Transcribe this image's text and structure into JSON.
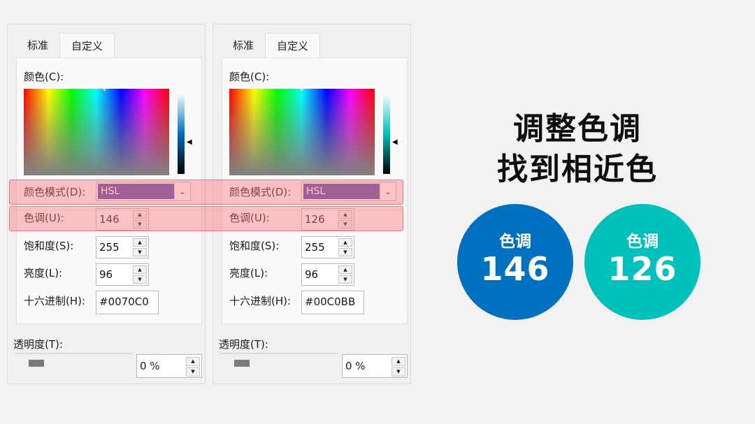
{
  "left_dialog": {
    "tabs": [
      "标准",
      "自定义"
    ],
    "colors_label": "颜色(C):",
    "mode_label": "颜色模式(D):",
    "mode_value": "HSL",
    "hue_label": "色调(U):",
    "hue_value": "146",
    "sat_label": "饱和度(S):",
    "sat_value": "255",
    "lum_label": "亮度(L):",
    "lum_value": "96",
    "hex_label": "十六进制(H):",
    "hex_value": "#0070C0",
    "transparency_label": "透明度(T):",
    "transparency_value": "0 %",
    "lum_color": "#0070c0"
  },
  "right_dialog": {
    "tabs": [
      "标准",
      "自定义"
    ],
    "colors_label": "颜色(C):",
    "mode_label": "颜色模式(D):",
    "mode_value": "HSL",
    "hue_label": "色调(U):",
    "hue_value": "126",
    "sat_label": "饱和度(S):",
    "sat_value": "255",
    "lum_label": "亮度(L):",
    "lum_value": "96",
    "hex_label": "十六进制(H):",
    "hex_value": "#00C0BB",
    "transparency_label": "透明度(T):",
    "transparency_value": "0 %",
    "lum_color": "#00c0bb"
  },
  "headline": {
    "line1": "调整色调",
    "line2": "找到相近色"
  },
  "badges": [
    {
      "label": "色调",
      "value": "146",
      "color": "#0070c0"
    },
    {
      "label": "色调",
      "value": "126",
      "color": "#00c0bb"
    }
  ],
  "highlight_color": "#ff7882"
}
